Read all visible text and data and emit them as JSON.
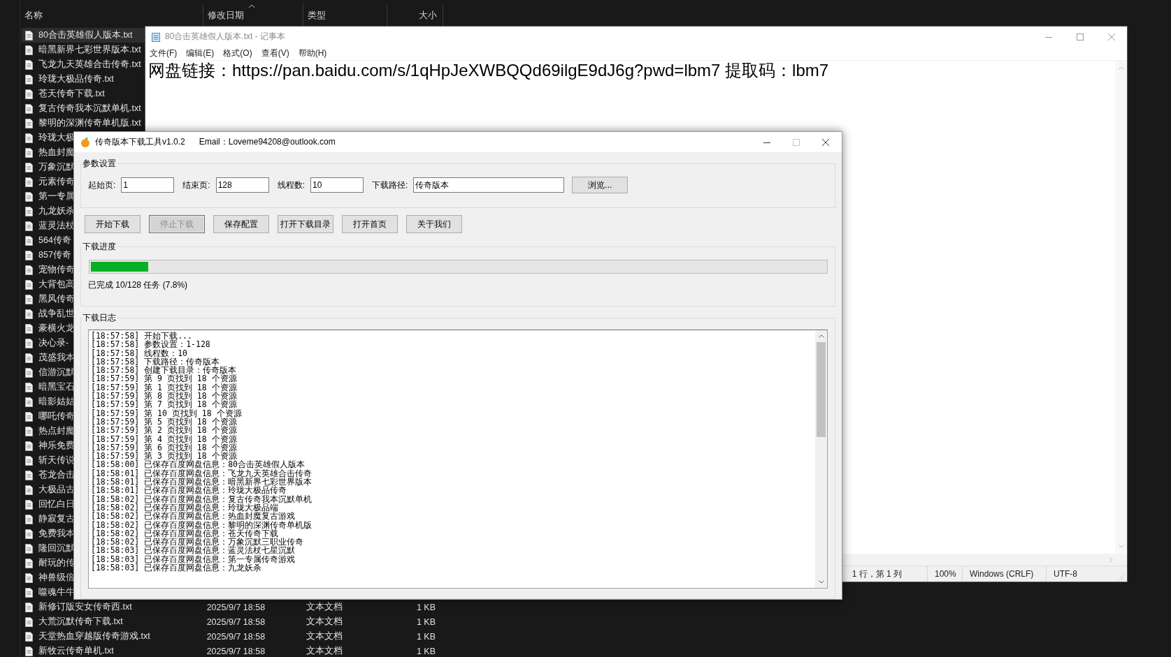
{
  "explorer": {
    "columns": [
      {
        "label": "名称",
        "sorted": false
      },
      {
        "label": "修改日期",
        "sorted": true
      },
      {
        "label": "类型",
        "sorted": false
      },
      {
        "label": "大小",
        "sorted": false
      }
    ],
    "files": [
      {
        "name": "80合击英雄假人版本.txt",
        "selected": true
      },
      {
        "name": "暗黑新界七彩世界版本.txt",
        "selected": false
      },
      {
        "name": "飞龙九天英雄合击传奇.txt",
        "selected": false
      },
      {
        "name": "玲珑大极品传奇.txt",
        "selected": false
      },
      {
        "name": "苍天传奇下载.txt",
        "selected": false
      },
      {
        "name": "复古传奇我本沉默单机.txt",
        "selected": false
      },
      {
        "name": "黎明的深渊传奇单机版.txt",
        "selected": false
      },
      {
        "name": "玲珑大极",
        "selected": false
      },
      {
        "name": "热血封魔",
        "selected": false
      },
      {
        "name": "万象沉默",
        "selected": false
      },
      {
        "name": "元素传奇",
        "selected": false
      },
      {
        "name": "第一专属",
        "selected": false
      },
      {
        "name": "九龙妖杀",
        "selected": false
      },
      {
        "name": "蓝灵法杖",
        "selected": false
      },
      {
        "name": "564传奇",
        "selected": false
      },
      {
        "name": "857传奇",
        "selected": false
      },
      {
        "name": "宠物传奇",
        "selected": false
      },
      {
        "name": "大背包高",
        "selected": false
      },
      {
        "name": "黑风传奇",
        "selected": false
      },
      {
        "name": "战争乱世",
        "selected": false
      },
      {
        "name": "豪横火龙",
        "selected": false
      },
      {
        "name": "决心录-",
        "selected": false
      },
      {
        "name": "茂盛我本",
        "selected": false
      },
      {
        "name": "信游沉默",
        "selected": false
      },
      {
        "name": "暗黑宝石",
        "selected": false
      },
      {
        "name": "暗影姑姑",
        "selected": false
      },
      {
        "name": "哪吒传奇",
        "selected": false
      },
      {
        "name": "热点封魔",
        "selected": false
      },
      {
        "name": "神乐免费",
        "selected": false
      },
      {
        "name": "斩天传说",
        "selected": false
      },
      {
        "name": "苍龙合击",
        "selected": false
      },
      {
        "name": "大极品古",
        "selected": false
      },
      {
        "name": "回忆白日",
        "selected": false
      },
      {
        "name": "静寂复古",
        "selected": false
      },
      {
        "name": "免费我本",
        "selected": false
      },
      {
        "name": "隆回沉默",
        "selected": false
      },
      {
        "name": "耐玩的传",
        "selected": false
      },
      {
        "name": "神兽级倍",
        "selected": false
      },
      {
        "name": "噬魂牛牛",
        "selected": false
      },
      {
        "name": "新修订版安女传奇西.txt",
        "date": "2025/9/7 18:58",
        "type": "文本文档",
        "size": "1 KB",
        "selected": false
      },
      {
        "name": "大荒沉默传奇下载.txt",
        "date": "2025/9/7 18:58",
        "type": "文本文档",
        "size": "1 KB",
        "selected": false
      },
      {
        "name": "天堂热血穿越版传奇游戏.txt",
        "date": "2025/9/7 18:58",
        "type": "文本文档",
        "size": "1 KB",
        "selected": false
      },
      {
        "name": "新牧云传奇单机.txt",
        "date": "2025/9/7 18:58",
        "type": "文本文档",
        "size": "1 KB",
        "selected": false
      }
    ]
  },
  "notepad": {
    "title": "80合击英雄假人版本.txt - 记事本",
    "menu": [
      "文件(F)",
      "编辑(E)",
      "格式(O)",
      "查看(V)",
      "帮助(H)"
    ],
    "text": "网盘链接：https://pan.baidu.com/s/1qHpJeXWBQQd69ilgE9dJ6g?pwd=lbm7  提取码：lbm7",
    "status": [
      "1 行，第 1 列",
      "100%",
      "Windows (CRLF)",
      "UTF-8"
    ]
  },
  "dialog": {
    "title": "传奇版本下载工具v1.0.2",
    "email": "Email：Loveme94208@outlook.com",
    "maximize_disabled": true,
    "settings": {
      "label": "参数设置",
      "fields": [
        {
          "label": "起始页:",
          "value": "1"
        },
        {
          "label": "结束页:",
          "value": "128"
        },
        {
          "label": "线程数:",
          "value": "10"
        },
        {
          "label": "下载路径:",
          "value": "传奇版本"
        }
      ],
      "browse": "浏览..."
    },
    "buttons": [
      {
        "label": "开始下载",
        "disabled": false
      },
      {
        "label": "停止下载",
        "disabled": true
      },
      {
        "label": "保存配置",
        "disabled": false
      },
      {
        "label": "打开下载目录",
        "disabled": false
      },
      {
        "label": "打开首页",
        "disabled": false
      },
      {
        "label": "关于我们",
        "disabled": false
      }
    ],
    "progress": {
      "label": "下载进度",
      "level": 0.078,
      "text": "已完成 10/128 任务 (7.8%)"
    },
    "log": {
      "label": "下载日志",
      "lines": [
        "[18:57:58] 开始下载...",
        "[18:57:58] 参数设置：1-128",
        "[18:57:58] 线程数：10",
        "[18:57:58] 下载路径：传奇版本",
        "[18:57:58] 创建下载目录：传奇版本",
        "[18:57:59] 第 9 页找到 18 个资源",
        "[18:57:59] 第 1 页找到 18 个资源",
        "[18:57:59] 第 8 页找到 18 个资源",
        "[18:57:59] 第 7 页找到 18 个资源",
        "[18:57:59] 第 10 页找到 18 个资源",
        "[18:57:59] 第 5 页找到 18 个资源",
        "[18:57:59] 第 2 页找到 18 个资源",
        "[18:57:59] 第 4 页找到 18 个资源",
        "[18:57:59] 第 6 页找到 18 个资源",
        "[18:57:59] 第 3 页找到 18 个资源",
        "[18:58:00] 已保存百度网盘信息：80合击英雄假人版本",
        "[18:58:01] 已保存百度网盘信息：飞龙九天英雄合击传奇",
        "[18:58:01] 已保存百度网盘信息：暗黑新界七彩世界版本",
        "[18:58:01] 已保存百度网盘信息：玲珑大极品传奇",
        "[18:58:02] 已保存百度网盘信息：复古传奇我本沉默单机",
        "[18:58:02] 已保存百度网盘信息：玲珑大极品端",
        "[18:58:02] 已保存百度网盘信息：热血封魔复古游戏",
        "[18:58:02] 已保存百度网盘信息：黎明的深渊传奇单机版",
        "[18:58:02] 已保存百度网盘信息：苍天传奇下载",
        "[18:58:02] 已保存百度网盘信息：万象沉默三职业传奇",
        "[18:58:03] 已保存百度网盘信息：蓝灵法杖七星沉默",
        "[18:58:03] 已保存百度网盘信息：第一专属传奇游戏",
        "[18:58:03] 已保存百度网盘信息：九龙妖杀"
      ]
    }
  }
}
